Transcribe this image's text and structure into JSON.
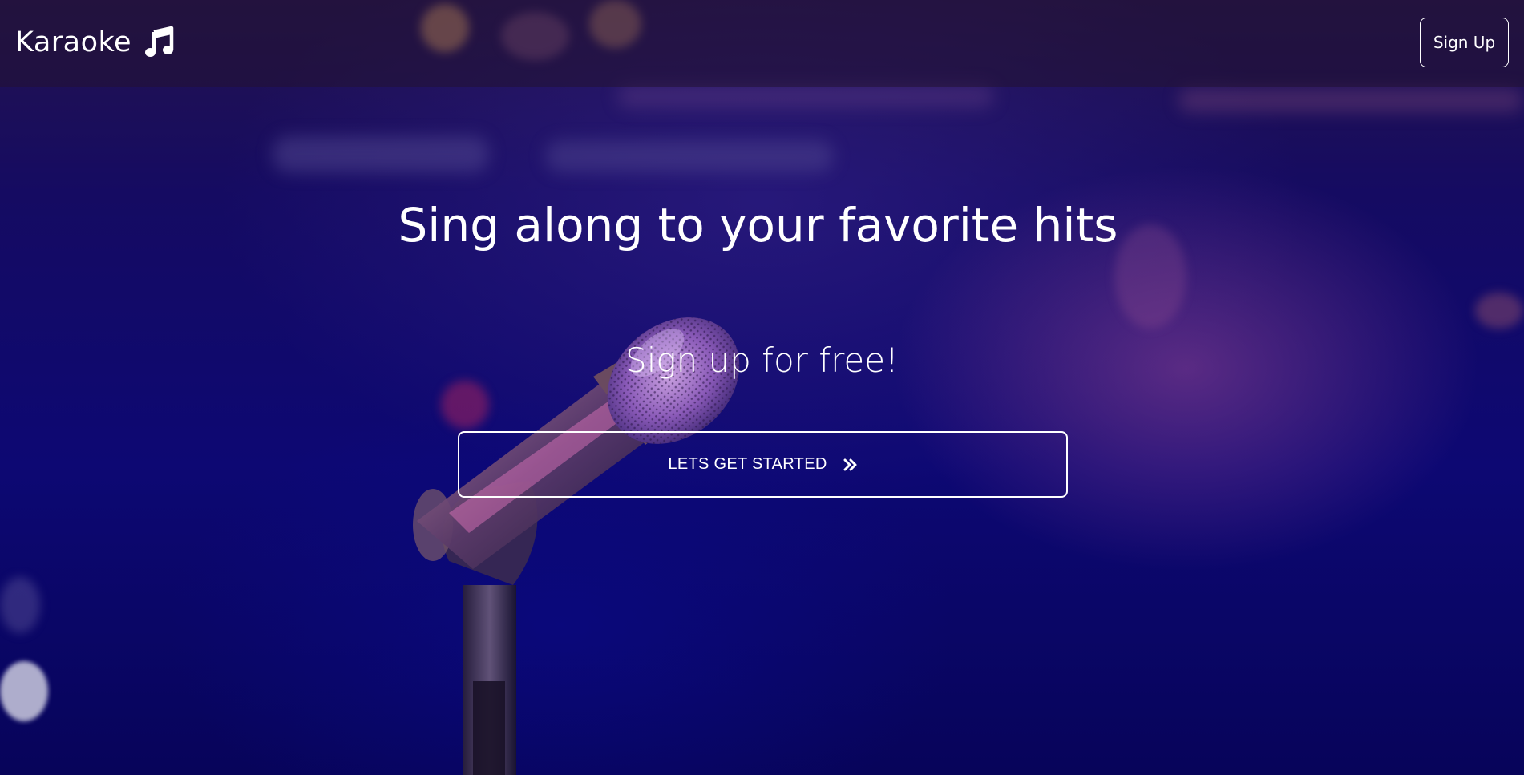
{
  "navbar": {
    "brand_label": "Karaoke",
    "brand_icon": "music-note-icon",
    "signup_label": "Sign Up"
  },
  "hero": {
    "title": "Sing along to your favorite hits",
    "subtitle": "Sign up for free!",
    "cta_label": "LETS GET STARTED",
    "cta_icon": "double-chevron-right-icon"
  },
  "colors": {
    "text": "#ffffff",
    "background_dark": "#0b0640",
    "background_blue": "#0d0873",
    "navbar_tint": "#231232"
  }
}
